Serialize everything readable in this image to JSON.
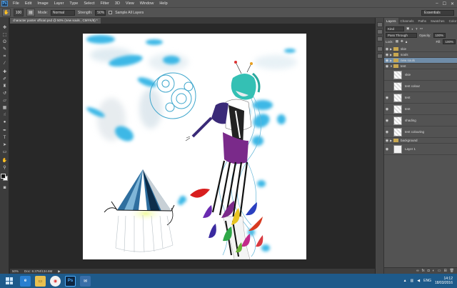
{
  "menu": [
    "File",
    "Edit",
    "Image",
    "Layer",
    "Type",
    "Select",
    "Filter",
    "3D",
    "View",
    "Window",
    "Help"
  ],
  "app_logo": "Ps",
  "window_controls": [
    "–",
    "☐",
    "✕"
  ],
  "options": {
    "brush_size": "100",
    "mode_label": "Mode:",
    "mode_value": "Normal",
    "strength_label": "Strength:",
    "strength_value": "50%",
    "sample_all_layers": "Sample All Layers",
    "workspace": "Essentials"
  },
  "document_tab": "character poster official.psd @ 50% (new souls , CMYK/8) *",
  "status": {
    "zoom": "50%",
    "doc": "Doc: 8.37M/134.6M"
  },
  "panel_tabs": [
    "Layers",
    "Channels",
    "Paths",
    "Swatches",
    "Color"
  ],
  "layers_panel": {
    "kind_label": "Kind",
    "blend_mode": "Pass Through",
    "opacity_label": "Opacity:",
    "opacity_value": "100%",
    "lock_label": "Lock:",
    "fill_label": "Fill:",
    "fill_value": "100%"
  },
  "layers": [
    {
      "name": "skie",
      "type": "group",
      "visible": true
    },
    {
      "name": "souls",
      "type": "group",
      "visible": true
    },
    {
      "name": "new souls",
      "type": "group",
      "visible": true,
      "selected": true
    },
    {
      "name": "tent",
      "type": "group",
      "visible": true,
      "open": true
    },
    {
      "name": "skie",
      "type": "layer",
      "visible": false
    },
    {
      "name": "tent colour",
      "type": "layer",
      "visible": false
    },
    {
      "name": "tent",
      "type": "layer",
      "visible": true
    },
    {
      "name": "tent",
      "type": "layer",
      "visible": true
    },
    {
      "name": "shading",
      "type": "layer",
      "visible": true
    },
    {
      "name": "tent colouring",
      "type": "layer",
      "visible": true
    },
    {
      "name": "background",
      "type": "group",
      "visible": true
    },
    {
      "name": "Layer 1",
      "type": "layer",
      "visible": true
    }
  ],
  "taskbar": {
    "apps": [
      "IE",
      "Files",
      "Chrome",
      "Ps",
      "Mail"
    ],
    "lang": "ENG",
    "time": "14:12",
    "date": "18/03/2016"
  },
  "colors": {
    "accent_blue": "#3cb8e6",
    "selection": "#6f8ca8",
    "taskbar": "#1e5a8a"
  }
}
